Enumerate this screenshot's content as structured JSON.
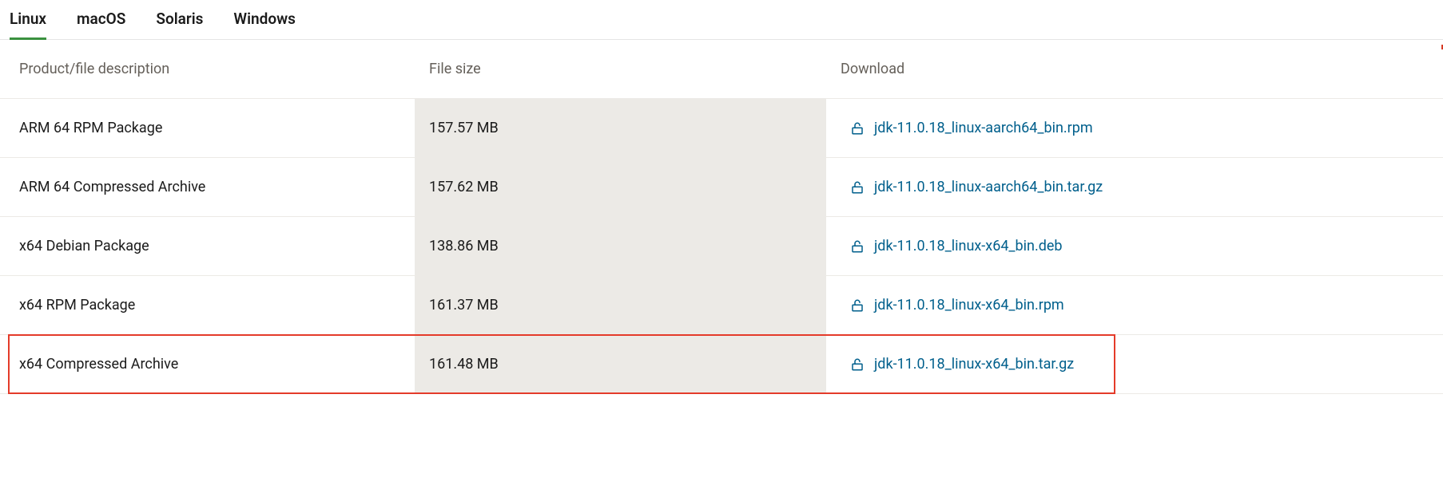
{
  "tabs": [
    {
      "label": "Linux",
      "active": true
    },
    {
      "label": "macOS",
      "active": false
    },
    {
      "label": "Solaris",
      "active": false
    },
    {
      "label": "Windows",
      "active": false
    }
  ],
  "headers": {
    "desc": "Product/file description",
    "size": "File size",
    "download": "Download"
  },
  "rows": [
    {
      "desc": "ARM 64 RPM Package",
      "size": "157.57 MB",
      "file": "jdk-11.0.18_linux-aarch64_bin.rpm",
      "highlight": false
    },
    {
      "desc": "ARM 64 Compressed Archive",
      "size": "157.62 MB",
      "file": "jdk-11.0.18_linux-aarch64_bin.tar.gz",
      "highlight": false
    },
    {
      "desc": "x64 Debian Package",
      "size": "138.86 MB",
      "file": "jdk-11.0.18_linux-x64_bin.deb",
      "highlight": false
    },
    {
      "desc": "x64 RPM Package",
      "size": "161.37 MB",
      "file": "jdk-11.0.18_linux-x64_bin.rpm",
      "highlight": false
    },
    {
      "desc": "x64 Compressed Archive",
      "size": "161.48 MB",
      "file": "jdk-11.0.18_linux-x64_bin.tar.gz",
      "highlight": true
    }
  ]
}
